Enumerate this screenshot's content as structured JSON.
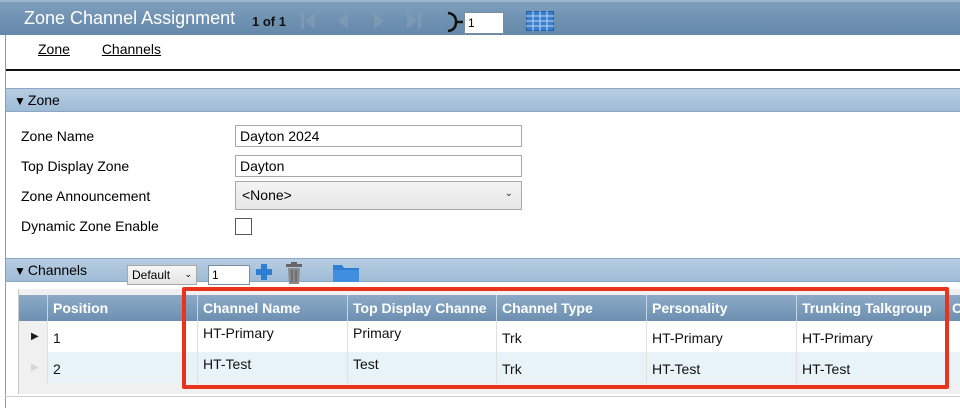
{
  "window": {
    "title": "Zone Channel Assignment"
  },
  "pager": {
    "text": "1 of 1",
    "page_value": "1"
  },
  "tabs": [
    {
      "label": "Zone"
    },
    {
      "label": "Channels"
    }
  ],
  "zone_section": {
    "label": "Zone",
    "fields": {
      "zone_name": {
        "label": "Zone Name",
        "value": "Dayton 2024"
      },
      "top_display_zone": {
        "label": "Top Display Zone",
        "value": "Dayton"
      },
      "zone_announcement": {
        "label": "Zone Announcement",
        "value": "<None>"
      },
      "dynamic_zone_enable": {
        "label": "Dynamic Zone Enable",
        "checked": false
      }
    }
  },
  "channels_section": {
    "label": "Channels",
    "view_select": "Default",
    "count_value": "1"
  },
  "grid": {
    "columns": [
      "Position",
      "Channel Name",
      "Top Display Channe",
      "Channel Type",
      "Personality",
      "Trunking Talkgroup",
      "C"
    ],
    "rows": [
      {
        "position": "1",
        "channel_name": "HT-Primary",
        "top_display_channel": "Primary",
        "channel_type": "Trk",
        "personality": "HT-Primary",
        "trunking_talkgroup": "HT-Primary"
      },
      {
        "position": "2",
        "channel_name": "HT-Test",
        "top_display_channel": "Test",
        "channel_type": "Trk",
        "personality": "HT-Test",
        "trunking_talkgroup": "HT-Test"
      }
    ]
  },
  "colors": {
    "title_bar": "#6f91b1",
    "section_bar": "#a9c2da",
    "grid_header": "#7c9dbd",
    "highlight": "#e8341c"
  },
  "icons": [
    "first-page-icon",
    "prev-page-icon",
    "next-page-icon",
    "last-page-icon",
    "go-to-page-icon",
    "grid-view-icon",
    "add-icon",
    "trash-icon",
    "folder-icon"
  ]
}
